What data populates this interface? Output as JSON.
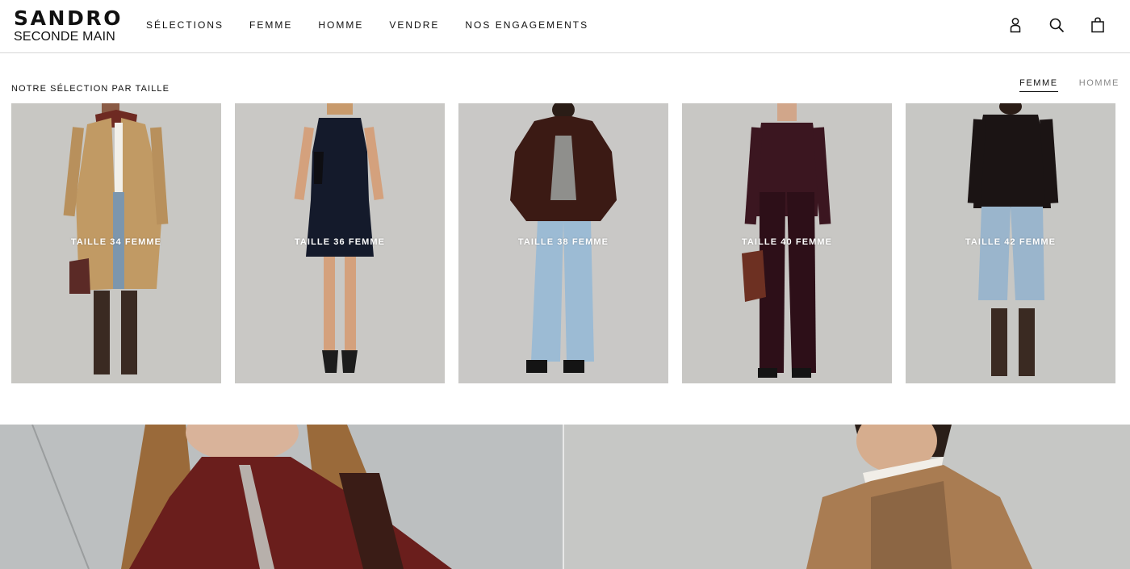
{
  "header": {
    "logo_line1": "SANDRO",
    "logo_line2": "SECONDE MAIN",
    "nav": [
      {
        "label": "SÉLECTIONS"
      },
      {
        "label": "FEMME"
      },
      {
        "label": "HOMME"
      },
      {
        "label": "VENDRE"
      },
      {
        "label": "NOS ENGAGEMENTS"
      }
    ],
    "icons": [
      "account-icon",
      "search-icon",
      "bag-icon"
    ]
  },
  "section": {
    "title": "NOTRE SÉLECTION PAR TAILLE",
    "tabs": [
      {
        "label": "FEMME",
        "active": true
      },
      {
        "label": "HOMME",
        "active": false
      }
    ]
  },
  "cards": [
    {
      "label": "TAILLE 34 FEMME"
    },
    {
      "label": "TAILLE 36 FEMME"
    },
    {
      "label": "TAILLE 38 FEMME"
    },
    {
      "label": "TAILLE 40 FEMME"
    },
    {
      "label": "TAILLE 42 FEMME"
    }
  ],
  "colors": {
    "text": "#111111",
    "inactive_tab": "#888888",
    "card_bg": "#c9c8c5",
    "divider": "#d6d6d6"
  }
}
